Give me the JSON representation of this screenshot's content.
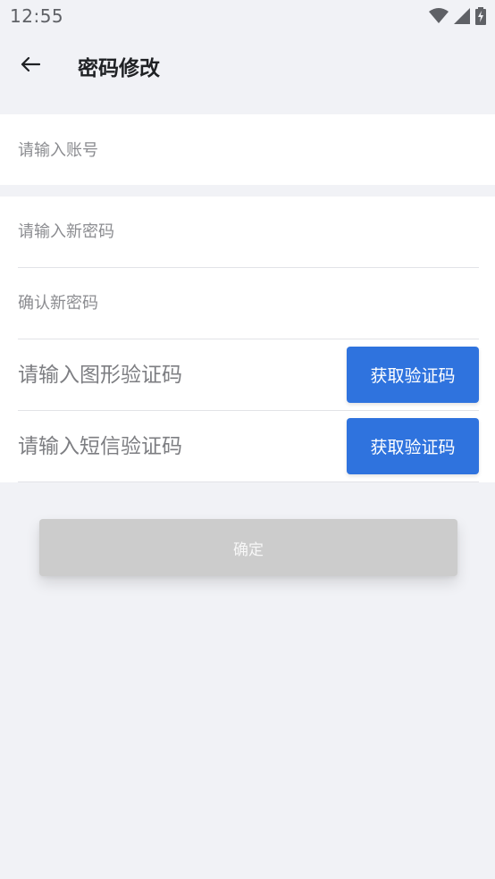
{
  "status_bar": {
    "time": "12:55",
    "icons": [
      "wifi-icon",
      "signal-icon",
      "battery-charging-icon"
    ]
  },
  "header": {
    "back_icon": "arrow-left-icon",
    "title": "密码修改"
  },
  "form": {
    "account_placeholder": "请输入账号",
    "new_password_placeholder": "请输入新密码",
    "confirm_password_placeholder": "确认新密码",
    "image_code_placeholder": "请输入图形验证码",
    "image_code_button": "获取验证码",
    "sms_code_placeholder": "请输入短信验证码",
    "sms_code_button": "获取验证码"
  },
  "confirm_button": "确定",
  "colors": {
    "background": "#f1f2f6",
    "accent": "#2f73de",
    "disabled_button": "#cccccc"
  }
}
